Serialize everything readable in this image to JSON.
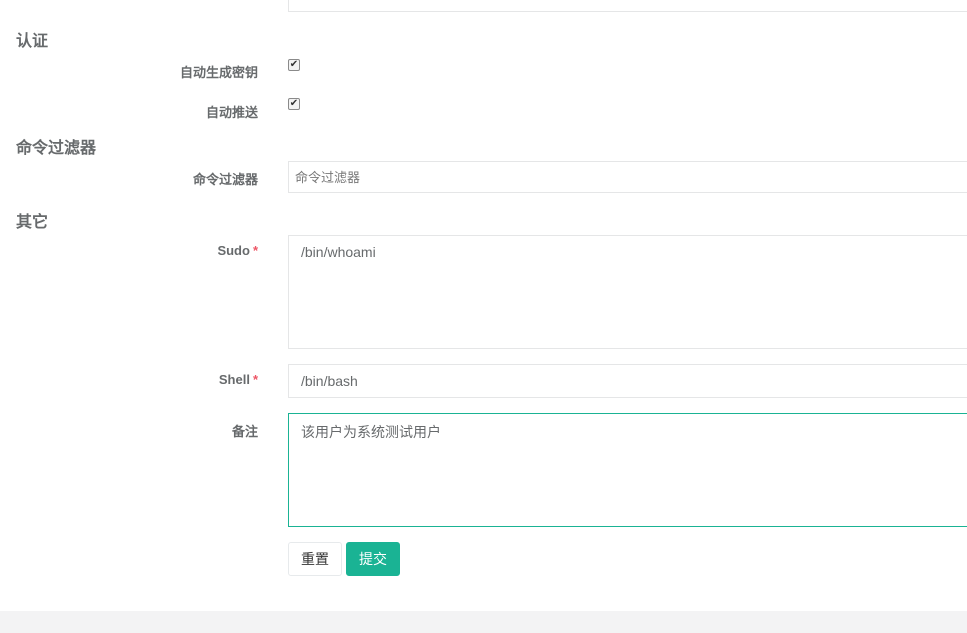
{
  "sections": {
    "auth": "认证",
    "command_filter": "命令过滤器",
    "other": "其它"
  },
  "fields": {
    "auto_generate_key": {
      "label": "自动生成密钥",
      "checked": true
    },
    "auto_push": {
      "label": "自动推送",
      "checked": true
    },
    "command_filter": {
      "label": "命令过滤器",
      "placeholder": "命令过滤器"
    },
    "sudo": {
      "label": "Sudo",
      "required_mark": "*",
      "value": "/bin/whoami"
    },
    "shell": {
      "label": "Shell",
      "required_mark": "*",
      "value": "/bin/bash"
    },
    "comment": {
      "label": "备注",
      "value": "该用户为系统测试用户"
    }
  },
  "buttons": {
    "reset": "重置",
    "submit": "提交"
  },
  "colors": {
    "primary": "#1ab394",
    "required": "#ed5565",
    "text": "#676a6c"
  }
}
